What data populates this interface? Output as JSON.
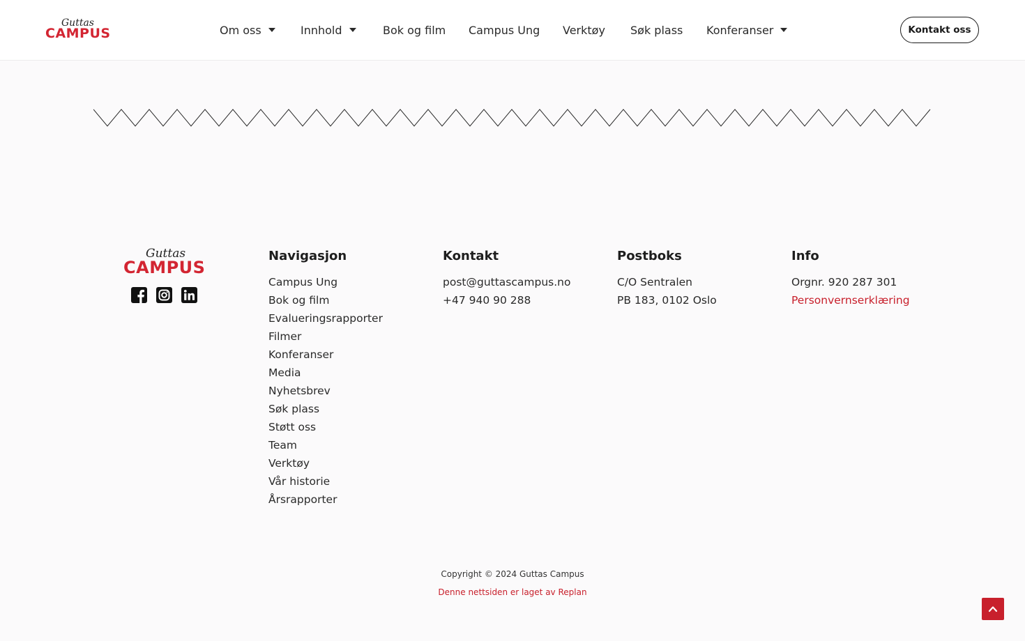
{
  "header": {
    "logo": {
      "script": "Guttas",
      "word": "CAMPUS"
    },
    "nav": [
      {
        "label": "Om oss",
        "has_dropdown": true
      },
      {
        "label": "Innhold",
        "has_dropdown": true
      },
      {
        "label": "Bok og film",
        "has_dropdown": false
      },
      {
        "label": "Campus Ung",
        "has_dropdown": false
      },
      {
        "label": "Verktøy",
        "has_dropdown": false
      },
      {
        "label": "Søk plass",
        "has_dropdown": false
      },
      {
        "label": "Konferanser",
        "has_dropdown": true
      }
    ],
    "cta_label": "Kontakt oss"
  },
  "footer": {
    "logo": {
      "script": "Guttas",
      "word": "CAMPUS"
    },
    "social": [
      {
        "icon": "facebook-square-icon"
      },
      {
        "icon": "instagram-icon"
      },
      {
        "icon": "linkedin-icon"
      }
    ],
    "navigation": {
      "title": "Navigasjon",
      "items": [
        "Campus Ung",
        "Bok og film",
        "Evalueringsrapporter",
        "Filmer",
        "Konferanser",
        "Media",
        "Nyhetsbrev",
        "Søk plass",
        "Støtt oss",
        "Team",
        "Verktøy",
        "Vår historie",
        "Årsrapporter"
      ]
    },
    "contact": {
      "title": "Kontakt",
      "email": "post@guttascampus.no",
      "phone": "+47 940 90 288"
    },
    "postbox": {
      "title": "Postboks",
      "line1": "C/O Sentralen",
      "line2": "PB 183, 0102 Oslo"
    },
    "info": {
      "title": "Info",
      "orgnr": "Orgnr. 920 287 301",
      "privacy": "Personvernserklæring"
    },
    "copyright": "Copyright © 2024 Guttas Campus",
    "credit": "Denne nettsiden er laget av Replan"
  },
  "colors": {
    "accent": "#c8202c",
    "logo_red": "#d32532",
    "text": "#2a2a2a",
    "background": "#fbfafb",
    "header_bg": "#ffffff"
  },
  "icons": {
    "dropdown": "caret-down-icon",
    "back_to_top": "chevron-up-icon"
  }
}
